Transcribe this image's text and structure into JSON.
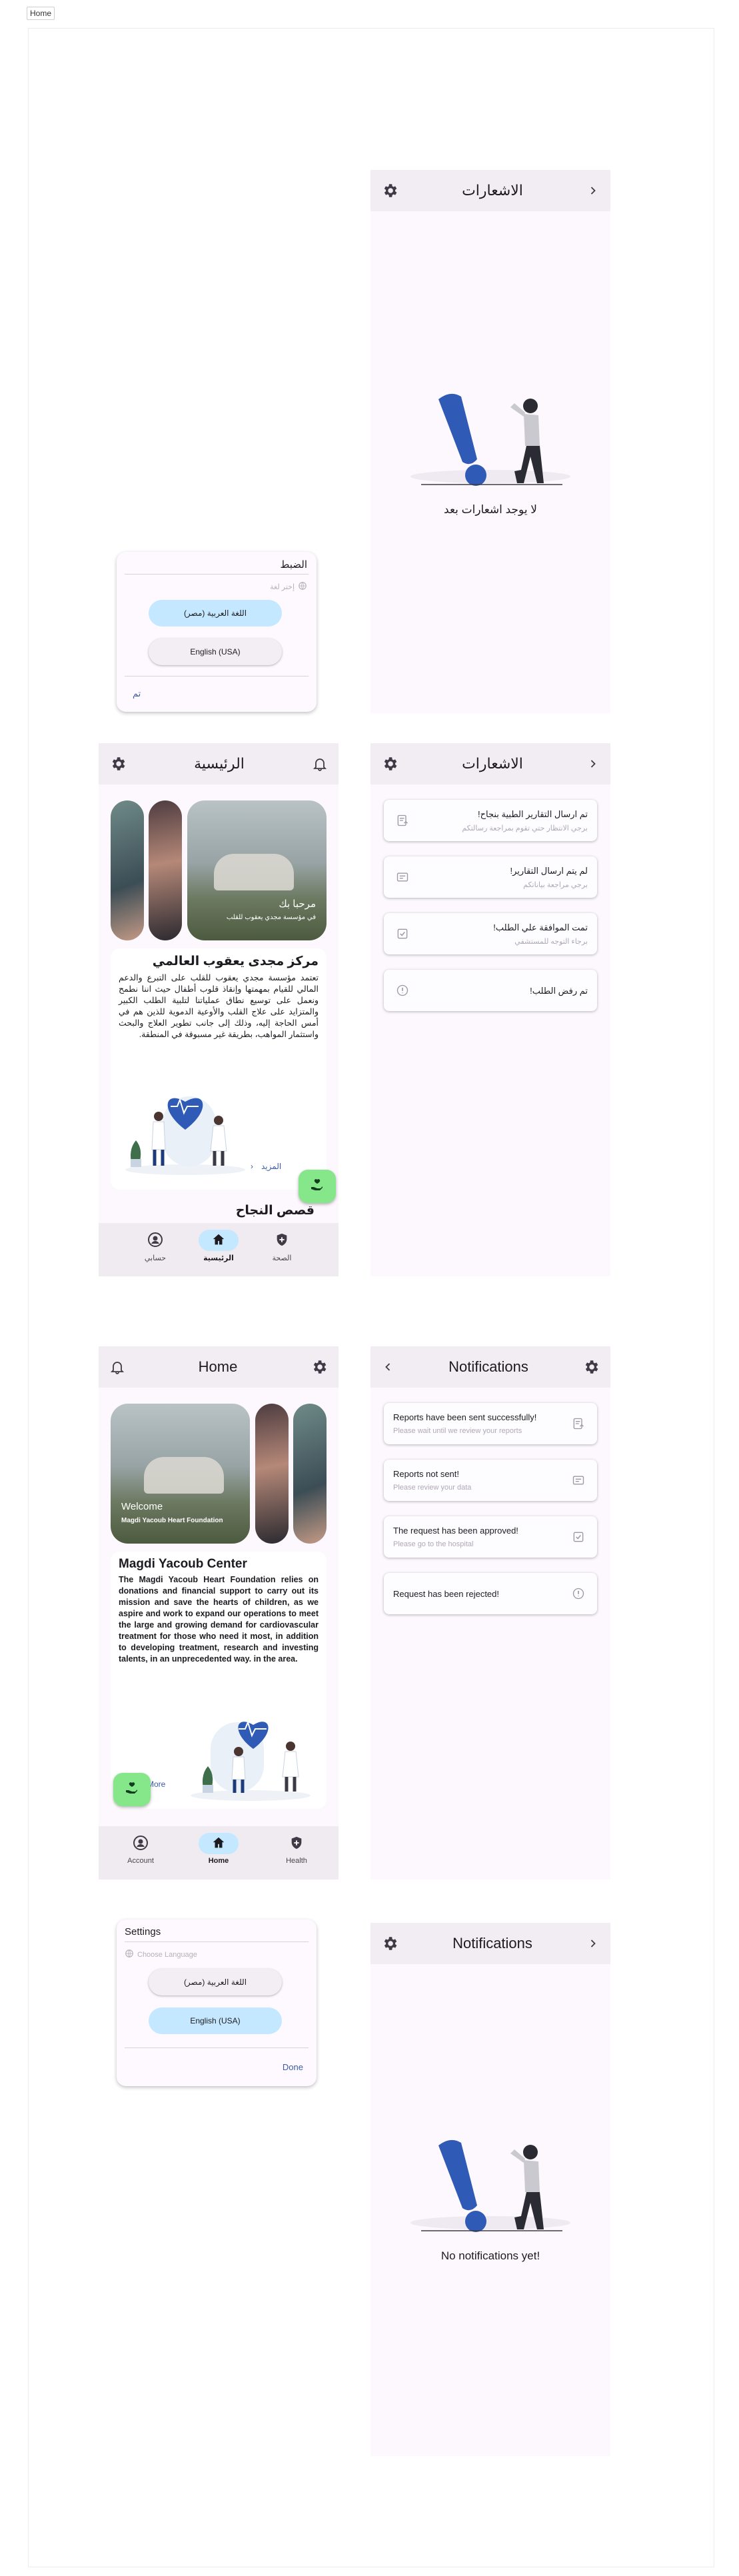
{
  "canvas": {
    "label": "Home"
  },
  "notif_empty_ar": {
    "title": "الاشعارات",
    "empty_text": "لا يوجد اشعارات بعد"
  },
  "settings_ar": {
    "title": "الضبط",
    "hint": "إختر لغة",
    "option_ar": "اللغة العربية (مصر)",
    "option_en": "English (USA)",
    "done": "تم"
  },
  "home_ar": {
    "title": "الرئيسية",
    "slide_title": "مرحبا بك",
    "slide_subtitle": "في مؤسسة مجدي يعقوب للقلب",
    "card_title": "مركز مجدى يعقوب العالمي",
    "card_body": "تعتمد مؤسسة مجدي يعقوب للقلب على التبرع والدعم المالي للقيام بمهمتها وإنقاذ قلوب أطفال حيث اننا نطمح ونعمل على توسيع نطاق عملياتنا لتلبية الطلب الكبير والمتزايد على علاج القلب والأوعية الدموية للذين هم في أمس الحاجة إليه، وذلك إلى جانب تطوير العلاج والبحث واستثمار المواهب، بطريقة غير مسبوقة في المنطقة.",
    "more": "المزيد",
    "section_title": "قصص النجاح",
    "nav": {
      "account": "حسابي",
      "home": "الرئيسية",
      "health": "الصحة"
    }
  },
  "notif_list_ar": {
    "title": "الاشعارات",
    "items": [
      {
        "title": "تم ارسال التقارير الطبية بنجاح!",
        "subtitle": "برجي الانتظار حتي تقوم بمراجعة رسالتكم",
        "icon": "report-sent-icon"
      },
      {
        "title": "لم يتم ارسال التقارير!",
        "subtitle": "برجي مراجعة بياناتكم",
        "icon": "report-failed-icon"
      },
      {
        "title": "تمت الموافقة علي الطلب!",
        "subtitle": "برجاء التوجه للمستشفي",
        "icon": "approved-icon"
      },
      {
        "title": "تم رفض الطلب!",
        "subtitle": "",
        "icon": "rejected-icon"
      }
    ]
  },
  "home_en": {
    "title": "Home",
    "slide_title": "Welcome",
    "slide_subtitle": "Magdi Yacoub Heart Foundation",
    "card_title": "Magdi Yacoub Center",
    "card_body": "The Magdi Yacoub Heart Foundation relies on donations and financial support to carry out its mission and save the hearts of children, as we aspire and work to expand our operations to meet the large and growing demand for cardiovascular treatment for those who need it most, in addition to developing treatment, research and investing talents, in an unprecedented way. in the area.",
    "more": "More",
    "nav": {
      "account": "Account",
      "home": "Home",
      "health": "Health"
    }
  },
  "notif_list_en": {
    "title": "Notifications",
    "items": [
      {
        "title": "Reports have been sent successfully!",
        "subtitle": "Please wait until we review your reports",
        "icon": "report-sent-icon"
      },
      {
        "title": "Reports not sent!",
        "subtitle": "Please review your data",
        "icon": "report-failed-icon"
      },
      {
        "title": "The request has been approved!",
        "subtitle": "Please go to the hospital",
        "icon": "approved-icon"
      },
      {
        "title": "Request has been rejected!",
        "subtitle": "",
        "icon": "rejected-icon"
      }
    ]
  },
  "settings_en": {
    "title": "Settings",
    "hint": "Choose Language",
    "option_ar": "اللغة العربية (مصر)",
    "option_en": "English (USA)",
    "done": "Done"
  },
  "notif_empty_en": {
    "title": "Notifications",
    "empty_text": "No notifications yet!"
  },
  "colors": {
    "accent_blue": "#c4e8ff",
    "fab_green": "#86e68a",
    "link_blue": "#3b5ba9",
    "appbar": "#f1edf3",
    "phone_bg": "#fcf8fd",
    "illustration_blue": "#2f5bb7"
  }
}
